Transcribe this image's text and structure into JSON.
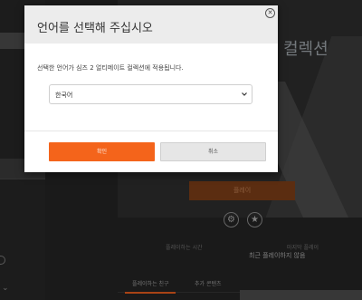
{
  "dialog": {
    "title": "언어를 선택해 주십시오",
    "description": "선택한 언어가 심즈 2 얼티메이트 컬렉션에 적용됩니다.",
    "language_select": {
      "selected": "한국어"
    },
    "confirm_label": "확인",
    "cancel_label": "취소",
    "close_icon": "close-icon"
  },
  "background": {
    "hero_title": "컬렉션",
    "play_label": "플레이",
    "icons": [
      "gear-icon",
      "star-icon"
    ],
    "meta": {
      "playtime_label": "플레이하는 시간",
      "last_played_label": "마지막 플레이",
      "last_played_value": "최근 플레이하지 않음"
    },
    "tabs": [
      "플레이하는 친구",
      "추가 콘텐츠"
    ]
  },
  "colors": {
    "accent": "#f4641b",
    "dialog_bg": "#ffffff",
    "header_bg": "#ececec"
  }
}
